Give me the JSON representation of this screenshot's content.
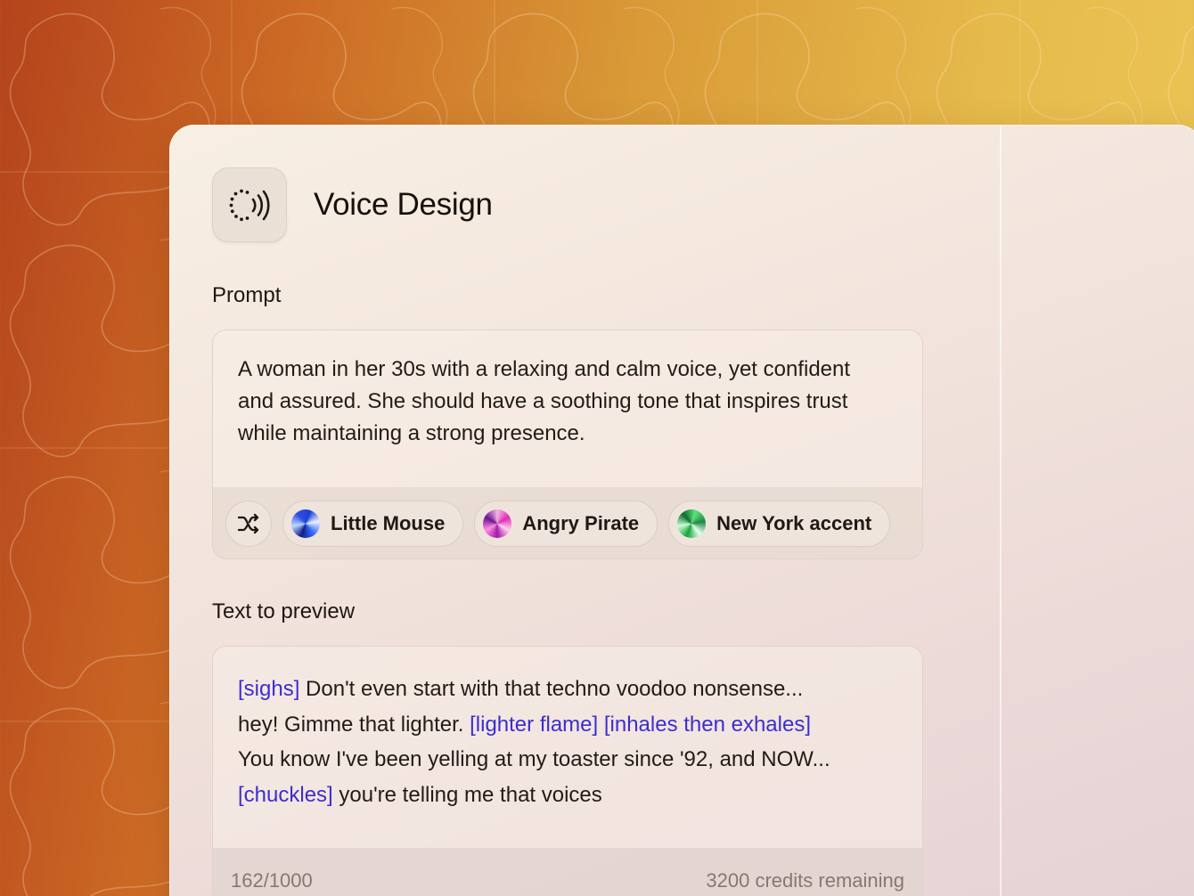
{
  "app": {
    "icon": "voice-waves-icon",
    "title": "Voice Design"
  },
  "prompt": {
    "label": "Prompt",
    "text": "A woman in her 30s with a relaxing and calm voice, yet confident and assured. She should have a soothing tone that inspires trust while maintaining a strong presence.",
    "shuffle_icon": "shuffle-icon",
    "suggestions": [
      {
        "label": "Little Mouse",
        "icon": "blue-orb-avatar"
      },
      {
        "label": "Angry Pirate",
        "icon": "pink-orb-avatar"
      },
      {
        "label": "New York accent",
        "icon": "green-orb-avatar"
      }
    ]
  },
  "preview": {
    "label": "Text to preview",
    "lines": [
      [
        {
          "text": "[sighs]",
          "tag": true
        },
        {
          "text": " Don't even start with that techno voodoo nonsense...",
          "tag": false
        }
      ],
      [
        {
          "text": "hey! Gimme that lighter. ",
          "tag": false
        },
        {
          "text": "[lighter flame]",
          "tag": true
        },
        {
          "text": " ",
          "tag": false
        },
        {
          "text": "[inhales then exhales]",
          "tag": true
        }
      ],
      [
        {
          "text": "You know I've been yelling at my toaster since '92, and NOW...",
          "tag": false
        }
      ],
      [
        {
          "text": "[chuckles]",
          "tag": true
        },
        {
          "text": " you're telling me that voices",
          "tag": false
        }
      ]
    ],
    "char_count": "162/1000",
    "credits": "3200 credits remaining"
  },
  "colors": {
    "tag": "#3b2ed0",
    "text": "#221b16",
    "muted": "#85796f",
    "background_warm": "#cc6a25",
    "background_gold": "#edc858"
  }
}
